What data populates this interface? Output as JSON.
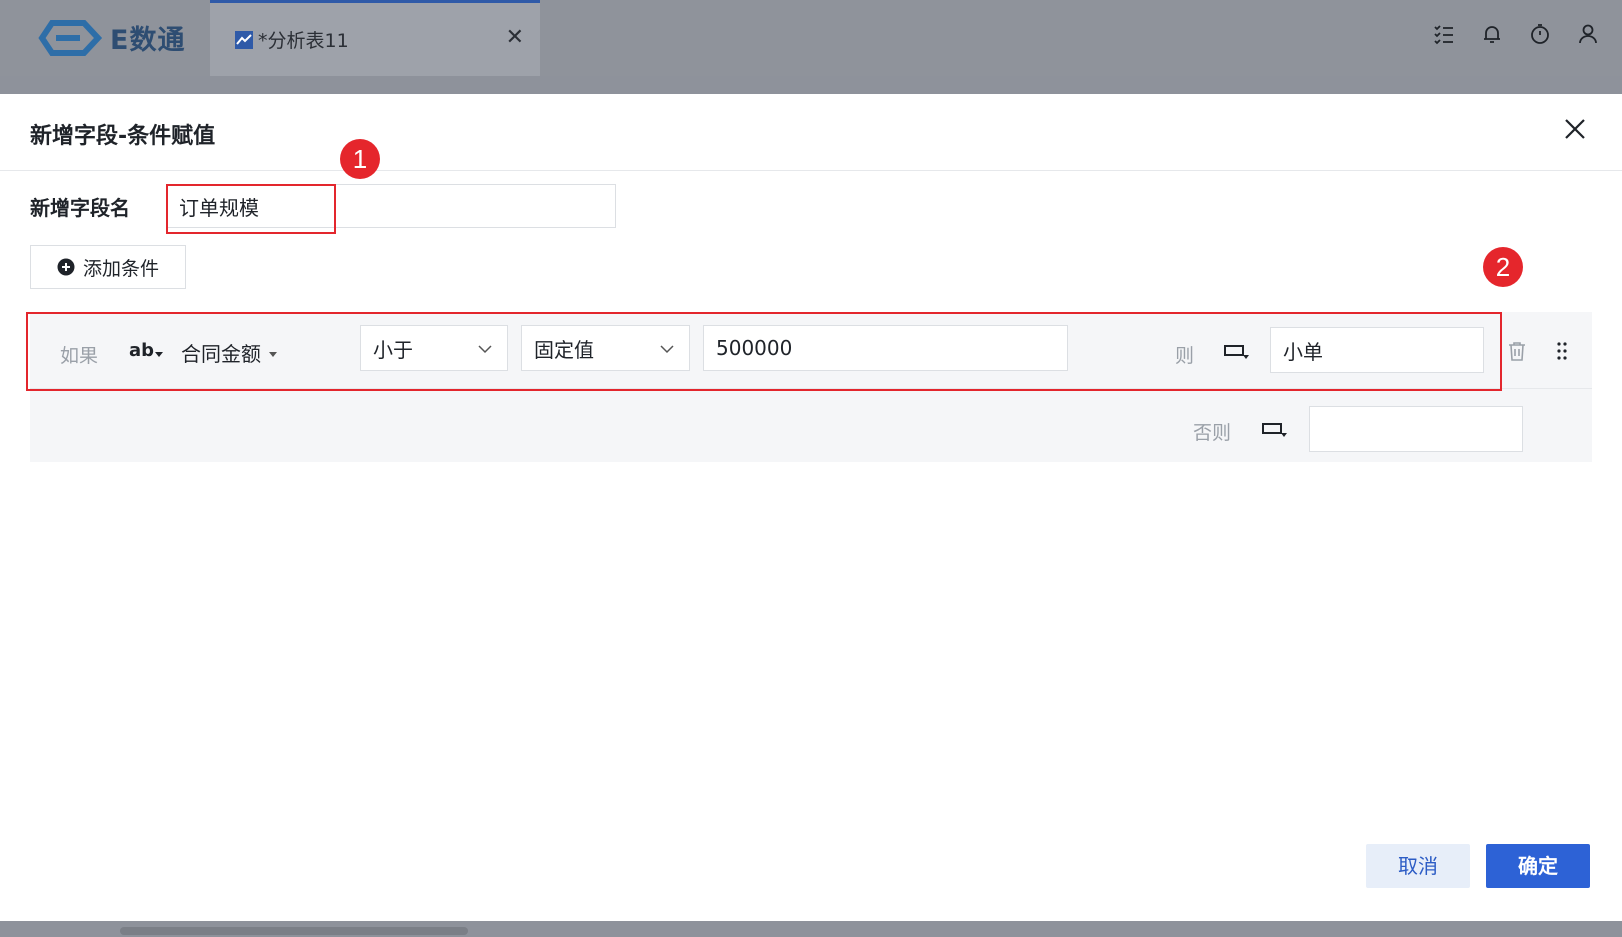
{
  "app": {
    "logo_text": "E数通"
  },
  "tab": {
    "label": "*分析表11"
  },
  "modal": {
    "title": "新增字段-条件赋值",
    "field_name_label": "新增字段名",
    "field_name_value": "订单规模",
    "add_condition_label": "添加条件",
    "annotations": [
      "1",
      "2"
    ],
    "condition": {
      "if_label": "如果",
      "type_icon_text": "ab",
      "field": "合同金额",
      "operator": "小于",
      "value_type": "固定值",
      "value": "500000",
      "then_label": "则",
      "then_value": "小单"
    },
    "else_label": "否则",
    "else_value": "",
    "cancel_label": "取消",
    "ok_label": "确定"
  },
  "colors": {
    "primary": "#2d62d6",
    "highlight": "#e3262d",
    "overlay": "#8e929b"
  }
}
